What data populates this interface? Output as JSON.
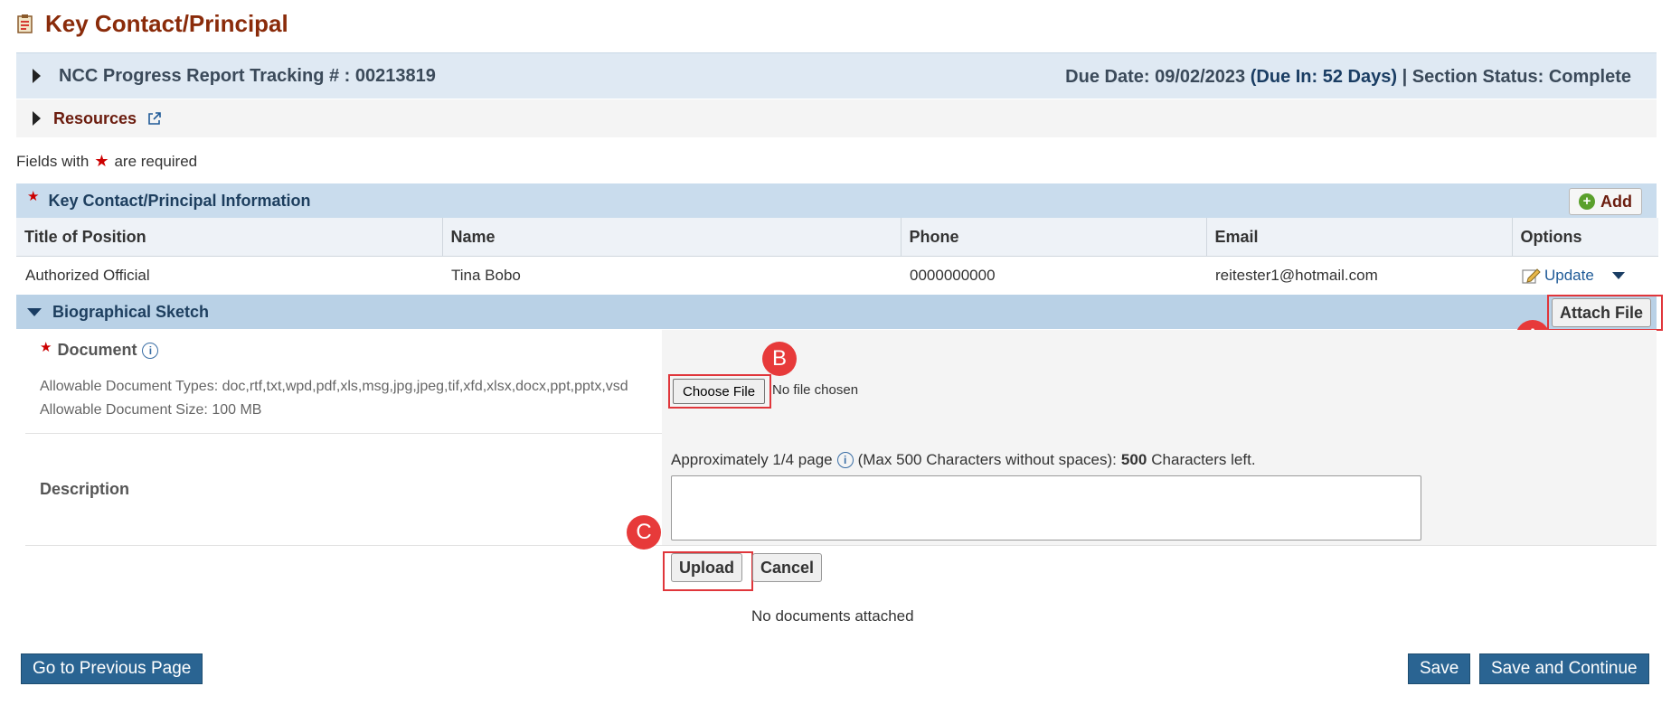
{
  "title": "Key Contact/Principal",
  "tracking": {
    "label": "NCC Progress Report Tracking # : 00213819",
    "due_date": "Due Date: 09/02/2023",
    "due_in": "(Due In: 52 Days)",
    "section_status": "| Section Status: Complete"
  },
  "resources": {
    "label": "Resources"
  },
  "required_note": {
    "prefix": "Fields with",
    "suffix": "are required"
  },
  "key_contact": {
    "title": "Key Contact/Principal Information",
    "add_label": "Add",
    "columns": [
      "Title of Position",
      "Name",
      "Phone",
      "Email",
      "Options"
    ],
    "rows": [
      {
        "title": "Authorized Official",
        "name": "Tina Bobo",
        "phone": "0000000000",
        "email": "reitester1@hotmail.com",
        "option": "Update"
      }
    ]
  },
  "bio": {
    "title": "Biographical Sketch",
    "attach_label": "Attach File",
    "document_label": "Document",
    "allowed_types": "Allowable Document Types: doc,rtf,txt,wpd,pdf,xls,msg,jpg,jpeg,tif,xfd,xlsx,docx,ppt,pptx,vsd",
    "allowed_size": "Allowable Document Size: 100 MB",
    "choose_label": "Choose File",
    "no_file": "No file chosen",
    "description_label": "Description",
    "desc_hint_a": "Approximately 1/4 page",
    "desc_hint_b": "(Max 500 Characters without spaces):",
    "desc_count": "500",
    "desc_hint_c": "Characters left.",
    "upload_label": "Upload",
    "cancel_label": "Cancel",
    "no_docs": "No documents attached"
  },
  "callouts": {
    "a": "A",
    "b": "B",
    "c": "C"
  },
  "footer": {
    "prev_label": "Go to Previous Page",
    "save_label": "Save",
    "save_continue_label": "Save and Continue"
  }
}
